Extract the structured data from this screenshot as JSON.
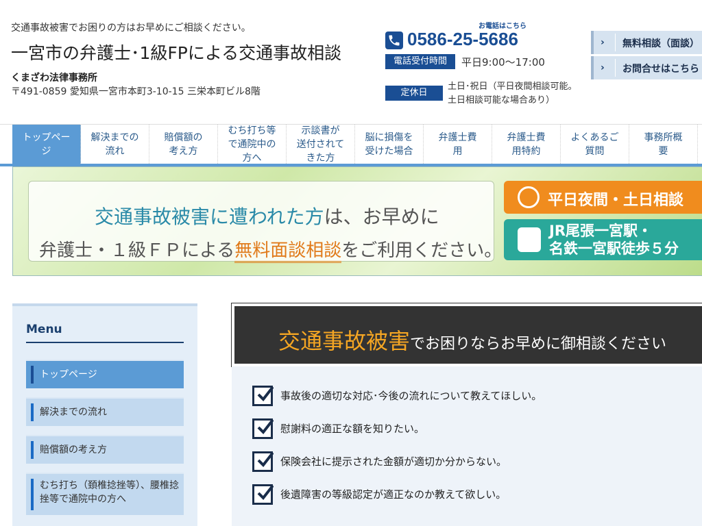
{
  "header": {
    "tagline": "交通事故被害でお困りの方はお早めにご相談ください。",
    "title": "一宮市の弁護士･1級FPによる交通事故相談",
    "firm_name": "くまざわ法律事務所",
    "address": "〒491-0859 愛知県一宮市本町3-10-15 三栄本町ビル8階",
    "phone_caption": "お電話はこちら",
    "phone_number": "0586-25-5686",
    "hours_label": "電話受付時間",
    "hours_value": "平日9:00～17:00",
    "closed_label": "定休日",
    "closed_line1": "土日･祝日（平日夜間相談可能。",
    "closed_line2": "土日相談可能な場合あり）",
    "buttons": [
      {
        "label": "無料相談（面談）"
      },
      {
        "label": "お問合せはこちら"
      }
    ]
  },
  "nav": {
    "items": [
      {
        "label": "トップペー\nジ",
        "active": true
      },
      {
        "label": "解決までの\n流れ"
      },
      {
        "label": "賠償額の\n考え方"
      },
      {
        "label": "むち打ち等\nで通院中の\n方へ"
      },
      {
        "label": "示談書が\n送付されて\nきた方"
      },
      {
        "label": "脳に損傷を\n受けた場合"
      },
      {
        "label": "弁護士費\n用"
      },
      {
        "label": "弁護士費\n用特約"
      },
      {
        "label": "よくあるご\n質問"
      },
      {
        "label": "事務所概\n要"
      }
    ]
  },
  "banner": {
    "line1_highlight": "交通事故被害に遭われた方",
    "line1_rest": "は、お早めに",
    "line2_prefix": "弁護士・１級ＦＰによる",
    "line2_highlight": "無料面談相談",
    "line2_suffix": "をご利用ください。",
    "tag_orange": "平日夜間・土日相談",
    "tag_teal_line1": "JR尾張一宮駅・",
    "tag_teal_line2": "名鉄一宮駅徒歩５分"
  },
  "sidebar": {
    "title": "Menu",
    "items": [
      {
        "label": "トップページ",
        "active": true
      },
      {
        "label": "解決までの流れ"
      },
      {
        "label": "賠償額の考え方"
      },
      {
        "label": "むち打ち（頚椎捻挫等）、腰椎捻挫等で通院中の方へ"
      }
    ]
  },
  "main": {
    "heading_highlight": "交通事故被害",
    "heading_rest": "でお困りならお早めに御相談ください",
    "checks": [
      "事故後の適切な対応･今後の流れについて教えてほしい。",
      "慰謝料の適正な額を知りたい。",
      "保険会社に提示された金額が適切か分からない。",
      "後遺障害の等級認定が適正なのか教えて欲しい。"
    ]
  },
  "colors": {
    "brand_navy": "#1a4e94",
    "nav_active": "#5b9bd5",
    "accent_orange": "#f5a623",
    "banner_teal": "#2aa89a"
  }
}
